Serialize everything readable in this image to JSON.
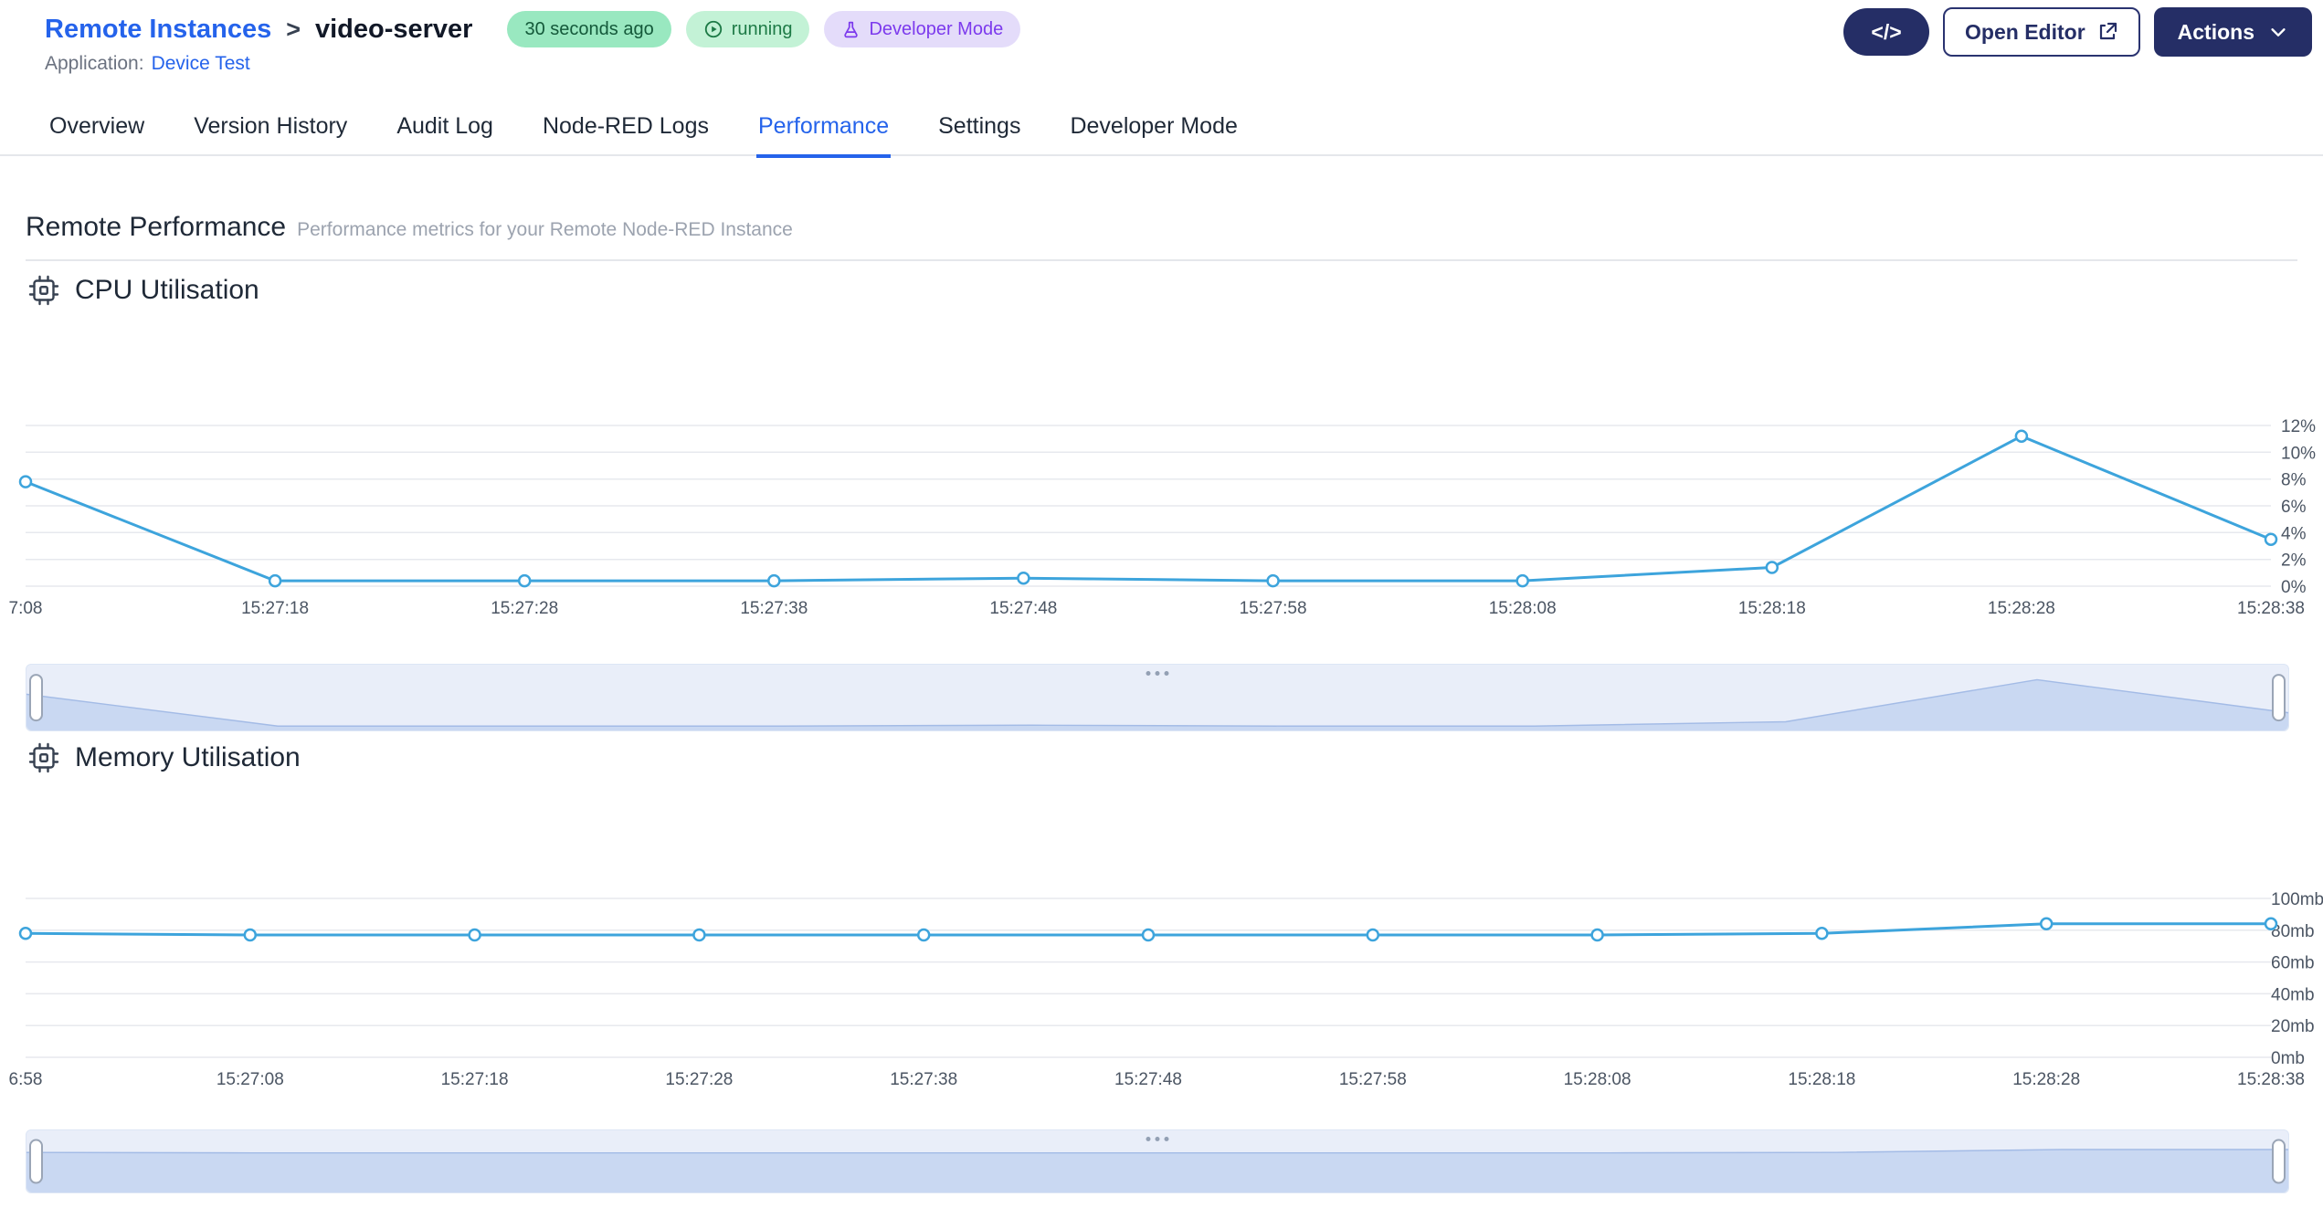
{
  "header": {
    "breadcrumb": {
      "root": "Remote Instances",
      "separator": ">",
      "current": "video-server"
    },
    "badges": {
      "last_seen": "30 seconds ago",
      "status": "running",
      "mode": "Developer Mode"
    },
    "application_label": "Application:",
    "application_name": "Device Test",
    "code_glyph": "</>",
    "open_editor_label": "Open Editor",
    "actions_label": "Actions"
  },
  "tabs": [
    {
      "label": "Overview"
    },
    {
      "label": "Version History"
    },
    {
      "label": "Audit Log"
    },
    {
      "label": "Node-RED Logs"
    },
    {
      "label": "Performance",
      "active": true
    },
    {
      "label": "Settings"
    },
    {
      "label": "Developer Mode"
    }
  ],
  "page": {
    "title": "Remote Performance",
    "subtitle": "Performance metrics for your Remote Node-RED Instance"
  },
  "sections": {
    "cpu_title": "CPU Utilisation",
    "memory_title": "Memory Utilisation"
  },
  "chart_data": [
    {
      "id": "cpu",
      "type": "line",
      "title": "CPU Utilisation",
      "x": [
        "7:08",
        "15:27:18",
        "15:27:28",
        "15:27:38",
        "15:27:48",
        "15:27:58",
        "15:28:08",
        "15:28:18",
        "15:28:28",
        "15:28:38"
      ],
      "values": [
        7.8,
        0.4,
        0.4,
        0.4,
        0.6,
        0.4,
        0.4,
        1.4,
        11.2,
        3.5
      ],
      "yticks": [
        0,
        2,
        4,
        6,
        8,
        10,
        12
      ],
      "ytick_suffix": "%",
      "ylim": [
        0,
        12
      ],
      "xlabel": "",
      "ylabel": "",
      "grid": true,
      "legend": "none",
      "tick_label_position": "right",
      "line_color": "#3da4dc"
    },
    {
      "id": "memory",
      "type": "line",
      "title": "Memory Utilisation",
      "x": [
        "6:58",
        "15:27:08",
        "15:27:18",
        "15:27:28",
        "15:27:38",
        "15:27:48",
        "15:27:58",
        "15:28:08",
        "15:28:18",
        "15:28:28",
        "15:28:38"
      ],
      "values": [
        78,
        77,
        77,
        77,
        77,
        77,
        77,
        77,
        78,
        84,
        84
      ],
      "yticks": [
        0,
        20,
        40,
        60,
        80,
        100
      ],
      "ytick_suffix": "mb",
      "ylim": [
        0,
        100
      ],
      "xlabel": "",
      "ylabel": "",
      "grid": true,
      "legend": "none",
      "tick_label_position": "right",
      "line_color": "#3da4dc"
    }
  ]
}
